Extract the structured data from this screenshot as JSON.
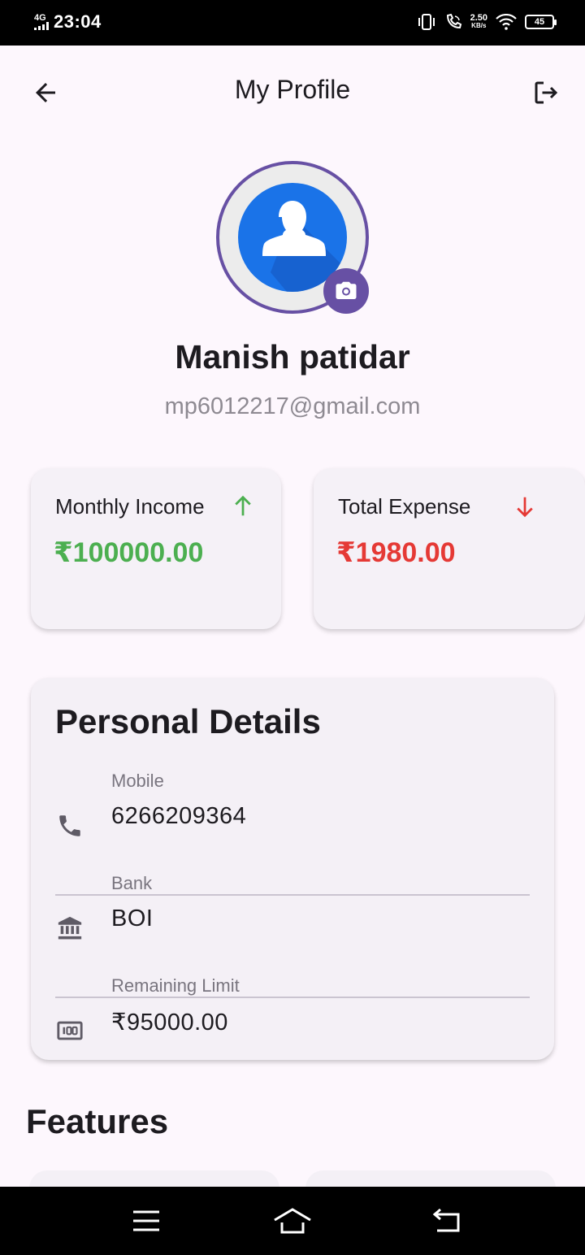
{
  "status_bar": {
    "network": "4G",
    "time": "23:04",
    "speed_value": "2.50",
    "speed_unit": "KB/s",
    "battery": "45"
  },
  "header": {
    "title": "My Profile",
    "back_icon": "arrow-left-icon",
    "logout_icon": "logout-icon"
  },
  "profile": {
    "name": "Manish patidar",
    "email": "mp6012217@gmail.com",
    "avatar_icon": "person-avatar-icon",
    "camera_icon": "camera-icon"
  },
  "stats": [
    {
      "label": "Monthly Income",
      "value": "₹100000.00",
      "trend": "up",
      "color": "#4caf50"
    },
    {
      "label": "Total Expense",
      "value": "₹1980.00",
      "trend": "down",
      "color": "#e53935"
    }
  ],
  "personal_details": {
    "title": "Personal Details",
    "items": [
      {
        "label": "Mobile",
        "value": "6266209364",
        "icon": "phone-icon"
      },
      {
        "label": "Bank",
        "value": "BOI",
        "icon": "bank-icon"
      },
      {
        "label": "Remaining Limit",
        "value": "₹95000.00",
        "icon": "money-icon"
      }
    ]
  },
  "features": {
    "title": "Features"
  },
  "colors": {
    "accent": "#6750a4",
    "avatar_blue": "#1a73e8",
    "income": "#4caf50",
    "expense": "#e53935",
    "background": "#fdf7fd"
  }
}
